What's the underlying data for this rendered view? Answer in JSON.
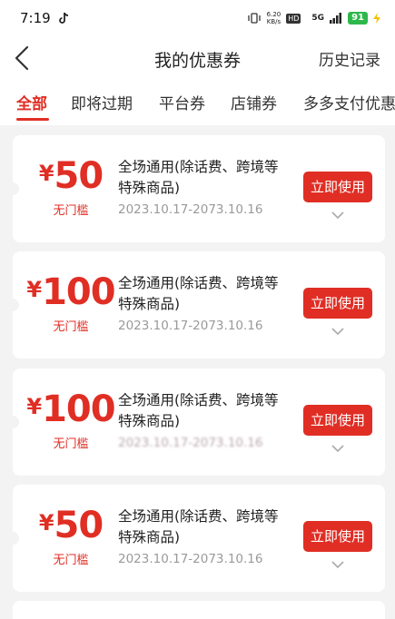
{
  "status": {
    "time": "7:19",
    "net_speed_value": "6.20",
    "net_speed_unit": "KB/s",
    "hd": "HD",
    "signal": "5G",
    "battery": "91"
  },
  "header": {
    "title": "我的优惠券",
    "history": "历史记录"
  },
  "tabs": [
    "全部",
    "即将过期",
    "平台券",
    "店铺券",
    "多多支付优惠"
  ],
  "coupons": [
    {
      "currency": "¥",
      "amount": "50",
      "condition": "无门槛",
      "title": "全场通用(除话费、跨境等特殊商品)",
      "date": "2023.10.17-2073.10.16",
      "button": "立即使用"
    },
    {
      "currency": "¥",
      "amount": "100",
      "condition": "无门槛",
      "title": "全场通用(除话费、跨境等特殊商品)",
      "date": "2023.10.17-2073.10.16",
      "button": "立即使用"
    },
    {
      "currency": "¥",
      "amount": "100",
      "condition": "无门槛",
      "title": "全场通用(除话费、跨境等特殊商品)",
      "date": "2023.10.17-2073.10.16",
      "button": "立即使用"
    },
    {
      "currency": "¥",
      "amount": "50",
      "condition": "无门槛",
      "title": "全场通用(除话费、跨境等特殊商品)",
      "date": "2023.10.17-2073.10.16",
      "button": "立即使用"
    }
  ],
  "colors": {
    "accent": "#e02e24",
    "background": "#f3f3f3",
    "muted": "#9a9a9a"
  },
  "icons": [
    "tiktok-icon",
    "vibrate-icon",
    "wifi-icon",
    "signal-icon",
    "battery-icon",
    "charging-icon",
    "back-icon",
    "chevron-down-icon"
  ]
}
